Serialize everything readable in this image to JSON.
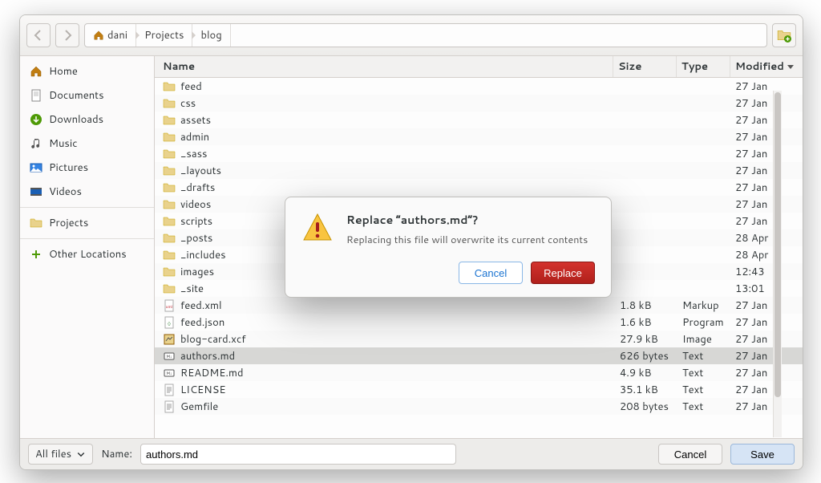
{
  "breadcrumbs": [
    {
      "label": "dani",
      "is_home": true
    },
    {
      "label": "Projects"
    },
    {
      "label": "blog"
    }
  ],
  "sidebar": {
    "items": [
      {
        "icon": "home",
        "label": "Home"
      },
      {
        "icon": "document",
        "label": "Documents"
      },
      {
        "icon": "download",
        "label": "Downloads"
      },
      {
        "icon": "music",
        "label": "Music"
      },
      {
        "icon": "pictures",
        "label": "Pictures"
      },
      {
        "icon": "videos",
        "label": "Videos"
      }
    ],
    "bookmarks": [
      {
        "icon": "folder",
        "label": "Projects"
      }
    ],
    "other_label": "Other Locations"
  },
  "columns": {
    "name": "Name",
    "size": "Size",
    "type": "Type",
    "modified": "Modified"
  },
  "files": [
    {
      "icon": "folder",
      "name": "feed",
      "size": "",
      "type": "",
      "modified": "27 Jan"
    },
    {
      "icon": "folder",
      "name": "css",
      "size": "",
      "type": "",
      "modified": "27 Jan"
    },
    {
      "icon": "folder",
      "name": "assets",
      "size": "",
      "type": "",
      "modified": "27 Jan"
    },
    {
      "icon": "folder",
      "name": "admin",
      "size": "",
      "type": "",
      "modified": "27 Jan"
    },
    {
      "icon": "folder",
      "name": "_sass",
      "size": "",
      "type": "",
      "modified": "27 Jan"
    },
    {
      "icon": "folder",
      "name": "_layouts",
      "size": "",
      "type": "",
      "modified": "27 Jan"
    },
    {
      "icon": "folder",
      "name": "_drafts",
      "size": "",
      "type": "",
      "modified": "27 Jan"
    },
    {
      "icon": "folder",
      "name": "videos",
      "size": "",
      "type": "",
      "modified": "27 Jan"
    },
    {
      "icon": "folder",
      "name": "scripts",
      "size": "",
      "type": "",
      "modified": "27 Jan"
    },
    {
      "icon": "folder",
      "name": "_posts",
      "size": "",
      "type": "",
      "modified": "28 Apr"
    },
    {
      "icon": "folder",
      "name": "_includes",
      "size": "",
      "type": "",
      "modified": "28 Apr"
    },
    {
      "icon": "folder",
      "name": "images",
      "size": "",
      "type": "",
      "modified": "12:43"
    },
    {
      "icon": "folder",
      "name": "_site",
      "size": "",
      "type": "",
      "modified": "13:01"
    },
    {
      "icon": "xml",
      "name": "feed.xml",
      "size": "1.8 kB",
      "type": "Markup",
      "modified": "27 Jan"
    },
    {
      "icon": "json",
      "name": "feed.json",
      "size": "1.6 kB",
      "type": "Program",
      "modified": "27 Jan"
    },
    {
      "icon": "xcf",
      "name": "blog-card.xcf",
      "size": "27.9 kB",
      "type": "Image",
      "modified": "27 Jan"
    },
    {
      "icon": "md",
      "name": "authors.md",
      "size": "626 bytes",
      "type": "Text",
      "modified": "27 Jan",
      "selected": true
    },
    {
      "icon": "md",
      "name": "README.md",
      "size": "4.9 kB",
      "type": "Text",
      "modified": "27 Jan"
    },
    {
      "icon": "text",
      "name": "LICENSE",
      "size": "35.1 kB",
      "type": "Text",
      "modified": "27 Jan"
    },
    {
      "icon": "text",
      "name": "Gemfile",
      "size": "208 bytes",
      "type": "Text",
      "modified": "27 Jan"
    }
  ],
  "actionbar": {
    "filter_label": "All files",
    "name_label": "Name:",
    "name_value": "authors.md",
    "cancel_label": "Cancel",
    "save_label": "Save"
  },
  "dialog": {
    "title": "Replace “authors.md”?",
    "message": "Replacing this file will overwrite its current contents",
    "cancel_label": "Cancel",
    "action_label": "Replace"
  }
}
